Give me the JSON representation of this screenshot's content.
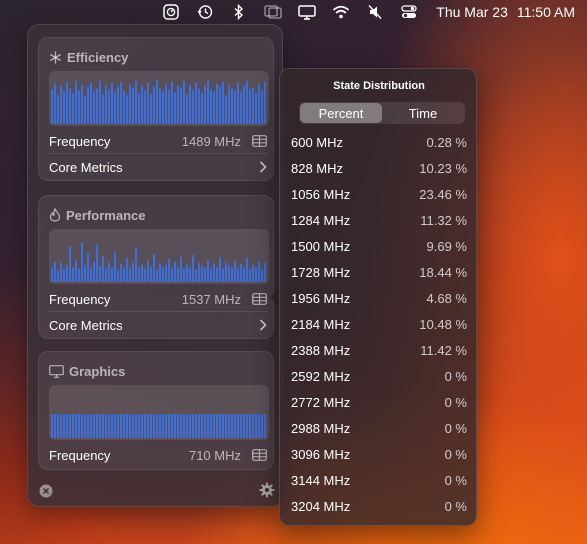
{
  "menubar": {
    "icons": [
      "stats-app-icon",
      "time-machine-icon",
      "bluetooth-icon",
      "screen-mirroring-icon",
      "display-icon",
      "wifi-icon",
      "sound-muted-icon",
      "control-center-icon"
    ],
    "date": "Thu Mar 23",
    "time": "11:50 AM"
  },
  "panel": {
    "efficiency": {
      "title": "Efficiency",
      "freq_label": "Frequency",
      "freq_value": "1489 MHz",
      "core_metrics_label": "Core Metrics",
      "bars": [
        0.72,
        0.85,
        0.6,
        0.8,
        0.7,
        0.88,
        0.75,
        0.65,
        0.9,
        0.7,
        0.82,
        0.6,
        0.78,
        0.86,
        0.68,
        0.74,
        0.9,
        0.62,
        0.8,
        0.72,
        0.85,
        0.66,
        0.78,
        0.88,
        0.7,
        0.6,
        0.82,
        0.76,
        0.9,
        0.64,
        0.8,
        0.7,
        0.86,
        0.62,
        0.78,
        0.92,
        0.74,
        0.68,
        0.84,
        0.72,
        0.88,
        0.66,
        0.8,
        0.76,
        0.9,
        0.62,
        0.82,
        0.7,
        0.86,
        0.74,
        0.64,
        0.8,
        0.9,
        0.72,
        0.68,
        0.84,
        0.78,
        0.88,
        0.6,
        0.82,
        0.74,
        0.7,
        0.86,
        0.66,
        0.8,
        0.9,
        0.72,
        0.76,
        0.64,
        0.84,
        0.7,
        0.88
      ]
    },
    "performance": {
      "title": "Performance",
      "freq_label": "Frequency",
      "freq_value": "1537 MHz",
      "core_metrics_label": "Core Metrics",
      "bars": [
        0.3,
        0.42,
        0.25,
        0.4,
        0.28,
        0.35,
        0.74,
        0.3,
        0.45,
        0.28,
        0.82,
        0.35,
        0.6,
        0.3,
        0.42,
        0.78,
        0.32,
        0.55,
        0.28,
        0.4,
        0.3,
        0.62,
        0.26,
        0.38,
        0.3,
        0.5,
        0.28,
        0.4,
        0.72,
        0.3,
        0.36,
        0.28,
        0.44,
        0.32,
        0.58,
        0.26,
        0.4,
        0.3,
        0.35,
        0.48,
        0.28,
        0.42,
        0.3,
        0.52,
        0.28,
        0.36,
        0.3,
        0.56,
        0.26,
        0.4,
        0.34,
        0.3,
        0.46,
        0.28,
        0.38,
        0.3,
        0.52,
        0.28,
        0.4,
        0.34,
        0.3,
        0.44,
        0.28,
        0.38,
        0.3,
        0.5,
        0.28,
        0.36,
        0.3,
        0.42,
        0.26,
        0.4
      ]
    },
    "graphics": {
      "title": "Graphics",
      "freq_label": "Frequency",
      "freq_value": "710 MHz",
      "bars": [
        0.5,
        0.5,
        0.5,
        0.5,
        0.5,
        0.5,
        0.5,
        0.5,
        0.5,
        0.5,
        0.5,
        0.5,
        0.5,
        0.5,
        0.5,
        0.5,
        0.5,
        0.5,
        0.5,
        0.5,
        0.5,
        0.5,
        0.5,
        0.5,
        0.5,
        0.5,
        0.5,
        0.5,
        0.5,
        0.5,
        0.5,
        0.5,
        0.5,
        0.5,
        0.5,
        0.5,
        0.5,
        0.5,
        0.5,
        0.5,
        0.5,
        0.5,
        0.5,
        0.5,
        0.5,
        0.5,
        0.5,
        0.5,
        0.5,
        0.5,
        0.5,
        0.5,
        0.5,
        0.5,
        0.5,
        0.5,
        0.5,
        0.5,
        0.5,
        0.5,
        0.5,
        0.5,
        0.5,
        0.5,
        0.5,
        0.5,
        0.5,
        0.5,
        0.5,
        0.5,
        0.5,
        0.5
      ]
    },
    "bar_color": "#3a6fe0"
  },
  "popover": {
    "title": "State Distribution",
    "tabs": [
      {
        "label": "Percent",
        "active": true
      },
      {
        "label": "Time",
        "active": false
      }
    ],
    "rows": [
      {
        "freq": "600 MHz",
        "pct": "0.28 %"
      },
      {
        "freq": "828 MHz",
        "pct": "10.23 %"
      },
      {
        "freq": "1056 MHz",
        "pct": "23.46 %"
      },
      {
        "freq": "1284 MHz",
        "pct": "11.32 %"
      },
      {
        "freq": "1500 MHz",
        "pct": "9.69 %"
      },
      {
        "freq": "1728 MHz",
        "pct": "18.44 %"
      },
      {
        "freq": "1956 MHz",
        "pct": "4.68 %"
      },
      {
        "freq": "2184 MHz",
        "pct": "10.48 %"
      },
      {
        "freq": "2388 MHz",
        "pct": "11.42 %"
      },
      {
        "freq": "2592 MHz",
        "pct": "0 %"
      },
      {
        "freq": "2772 MHz",
        "pct": "0 %"
      },
      {
        "freq": "2988 MHz",
        "pct": "0 %"
      },
      {
        "freq": "3096 MHz",
        "pct": "0 %"
      },
      {
        "freq": "3144 MHz",
        "pct": "0 %"
      },
      {
        "freq": "3204 MHz",
        "pct": "0 %"
      }
    ]
  }
}
